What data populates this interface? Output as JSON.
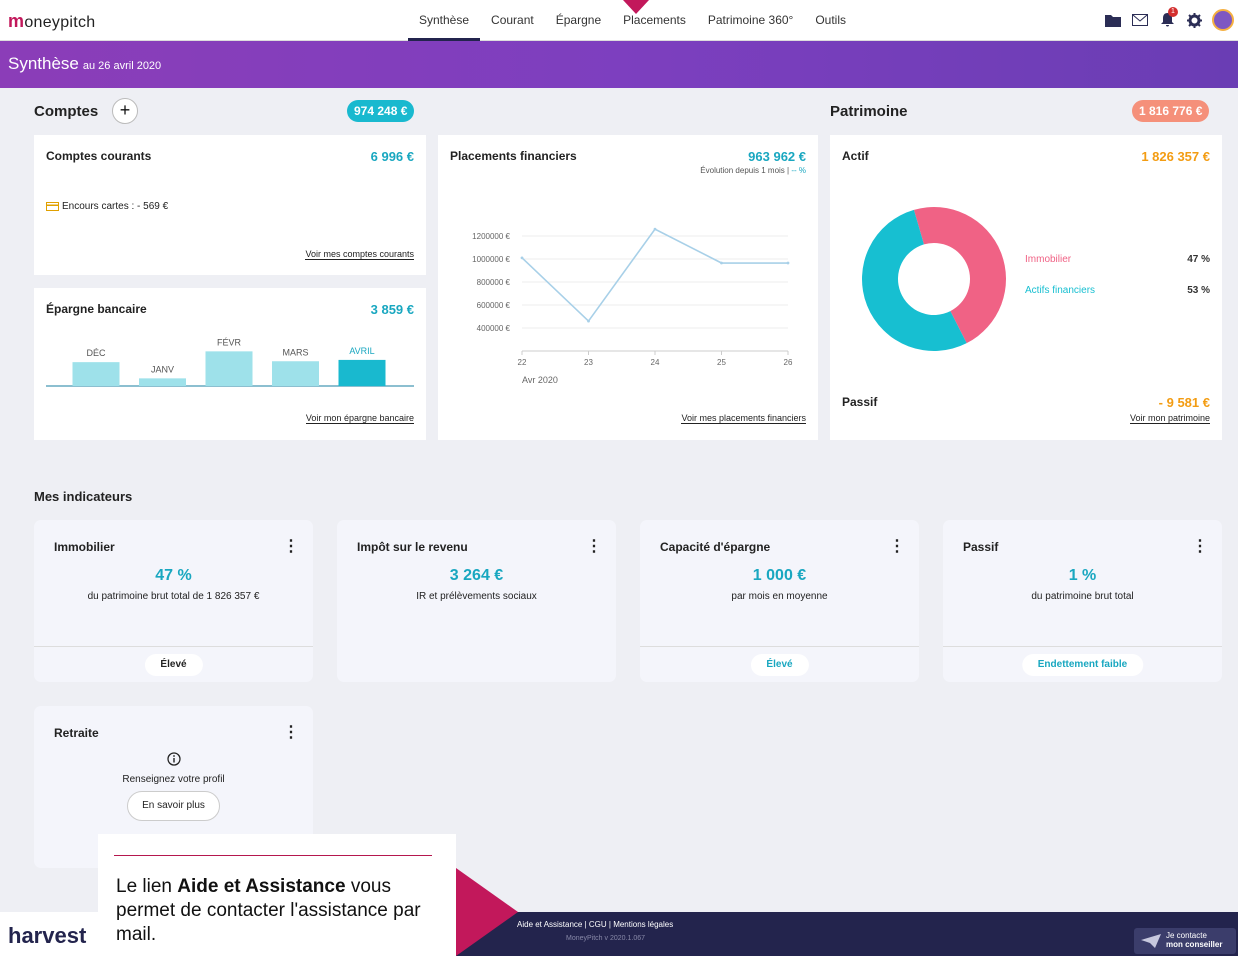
{
  "nav": {
    "logo": "oneypitch",
    "logo_m": "m",
    "links": [
      "Synthèse",
      "Courant",
      "Épargne",
      "Placements",
      "Patrimoine 360°",
      "Outils"
    ],
    "badge_count": "1"
  },
  "banner": {
    "title": "Synthèse",
    "subtitle": "au 26 avril 2020"
  },
  "comptes": {
    "title": "Comptes",
    "total": "974 248 €",
    "courants": {
      "title": "Comptes courants",
      "amount": "6 996 €",
      "encours": "Encours cartes : - 569 €",
      "link": "Voir mes comptes courants"
    },
    "epargne": {
      "title": "Épargne bancaire",
      "amount": "3 859 €",
      "link": "Voir mon épargne bancaire"
    },
    "placements": {
      "title": "Placements financiers",
      "amount": "963 962 €",
      "evolution_label": "Évolution depuis 1 mois",
      "evolution_value": "-- %",
      "link": "Voir mes placements financiers"
    }
  },
  "patrimoine": {
    "title": "Patrimoine",
    "total": "1 816 776 €",
    "actif_label": "Actif",
    "actif_amount": "1 826 357 €",
    "passif_label": "Passif",
    "passif_amount": "- 9 581 €",
    "link": "Voir mon patrimoine"
  },
  "indicateurs": {
    "title": "Mes indicateurs",
    "items": [
      {
        "title": "Immobilier",
        "value": "47 %",
        "sub": "du patrimoine brut total de 1 826 357 €",
        "badge": "Élevé"
      },
      {
        "title": "Impôt sur le revenu",
        "value": "3 264 €",
        "sub": "IR et prélèvements sociaux",
        "badge": ""
      },
      {
        "title": "Capacité d'épargne",
        "value": "1 000 €",
        "sub": "par mois en moyenne",
        "badge": "Élevé"
      },
      {
        "title": "Passif",
        "value": "1 %",
        "sub": "du patrimoine brut total",
        "badge": "Endettement faible"
      }
    ],
    "retraite": {
      "title": "Retraite",
      "text": "Renseignez votre profil",
      "button": "En savoir plus"
    }
  },
  "footer": {
    "brand": "harvest",
    "links": "Aide et Assistance  |  CGU  |  Mentions légales",
    "version": "MoneyPitch v 2020.1.067",
    "contact_line1": "Je contacte",
    "contact_line2": "mon conseiller"
  },
  "callout": {
    "pre": "Le lien ",
    "bold": "Aide et Assistance",
    "post": " vous permet de contacter l'assistance par mail."
  },
  "chart_data": [
    {
      "type": "bar",
      "categories": [
        "DÉC",
        "JANV",
        "FÉVR",
        "MARS",
        "AVRIL"
      ],
      "values": [
        0.53,
        0.17,
        0.77,
        0.55,
        0.58
      ],
      "highlight": "AVRIL",
      "colors": {
        "bar": "#9ee1ea",
        "active": "#19b9cf"
      }
    },
    {
      "type": "line",
      "x": [
        "22",
        "23",
        "24",
        "25",
        "26"
      ],
      "xlabel": "Avr 2020",
      "ylabel": "",
      "yticks": [
        "1200000 €",
        "1000000 €",
        "800000 €",
        "600000 €",
        "400000 €"
      ],
      "ylim": [
        200000,
        1400000
      ],
      "values": [
        1010000,
        460000,
        1260000,
        965000,
        965000
      ],
      "color": "#a8d0e8"
    },
    {
      "type": "pie",
      "labels": [
        "Immobilier",
        "Actifs financiers"
      ],
      "values": [
        47,
        53
      ],
      "value_labels": [
        "47 %",
        "53 %"
      ],
      "colors": [
        "#f06285",
        "#17bfd1"
      ]
    }
  ],
  "colors": {
    "teal": "#19a7c0",
    "orange": "#f39c12",
    "salmon": "#f5907a",
    "navy": "#23244d",
    "pink": "#c2185b"
  }
}
